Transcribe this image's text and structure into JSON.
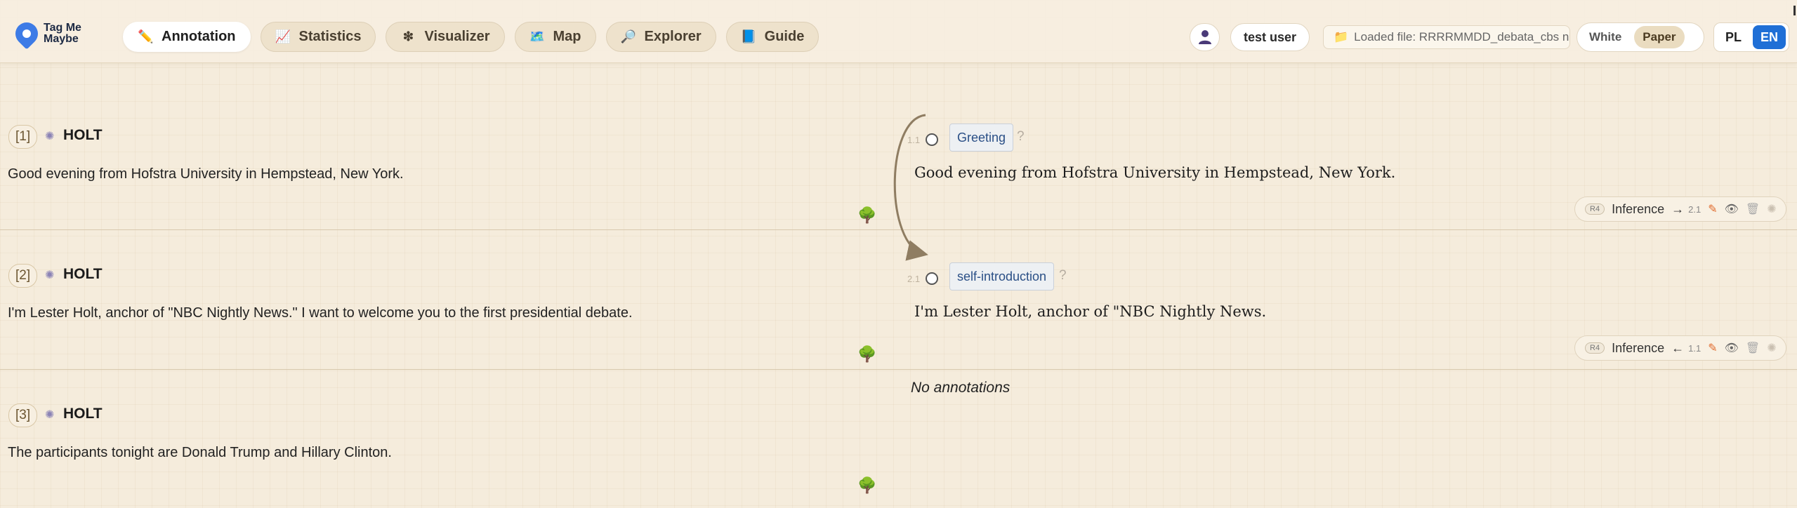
{
  "brand": {
    "name": "Tag Me Maybe"
  },
  "nav": [
    {
      "label": "Annotation",
      "icon": "✏️",
      "active": true
    },
    {
      "label": "Statistics",
      "icon": "📈",
      "active": false
    },
    {
      "label": "Visualizer",
      "icon": "❇",
      "active": false
    },
    {
      "label": "Map",
      "icon": "🗺️",
      "active": false
    },
    {
      "label": "Explorer",
      "icon": "🔎",
      "active": false
    },
    {
      "label": "Guide",
      "icon": "📘",
      "active": false
    }
  ],
  "user": {
    "name": "test user"
  },
  "file": {
    "label": "Loaded file: RRRRMMDD_debata_cbs n"
  },
  "theme": {
    "options": [
      "White",
      "Paper"
    ],
    "selected": "Paper"
  },
  "language": {
    "options": [
      "PL",
      "EN"
    ],
    "selected": "EN"
  },
  "rows": [
    {
      "id": "[1]",
      "speaker": "HOLT",
      "text": "Good evening from Hofstra University in Hempstead, New York.",
      "node_num": "1.1",
      "tag": "Greeting",
      "q": "?",
      "segment": "Good evening from Hofstra University in Hempstead, New York.",
      "relation": {
        "badge": "R4",
        "label": "Inference",
        "arrow": "→",
        "target": "2.1"
      }
    },
    {
      "id": "[2]",
      "speaker": "HOLT",
      "text": "I'm Lester Holt, anchor of \"NBC Nightly News.\" I want to welcome you to the first presidential debate.",
      "node_num": "2.1",
      "tag": "self-introduction",
      "q": "?",
      "segment": "I'm Lester Holt, anchor of \"NBC Nightly News.",
      "relation": {
        "badge": "R4",
        "label": "Inference",
        "arrow": "←",
        "target": "1.1"
      }
    },
    {
      "id": "[3]",
      "speaker": "HOLT",
      "text": "The participants tonight are Donald Trump and Hillary Clinton.",
      "empty_label": "No annotations"
    }
  ],
  "icons": {
    "gear": "gear-icon",
    "tree": "tree-icon",
    "edit": "pencil-icon",
    "view": "eye-icon",
    "delete": "trash-icon",
    "settings": "gear-icon"
  }
}
